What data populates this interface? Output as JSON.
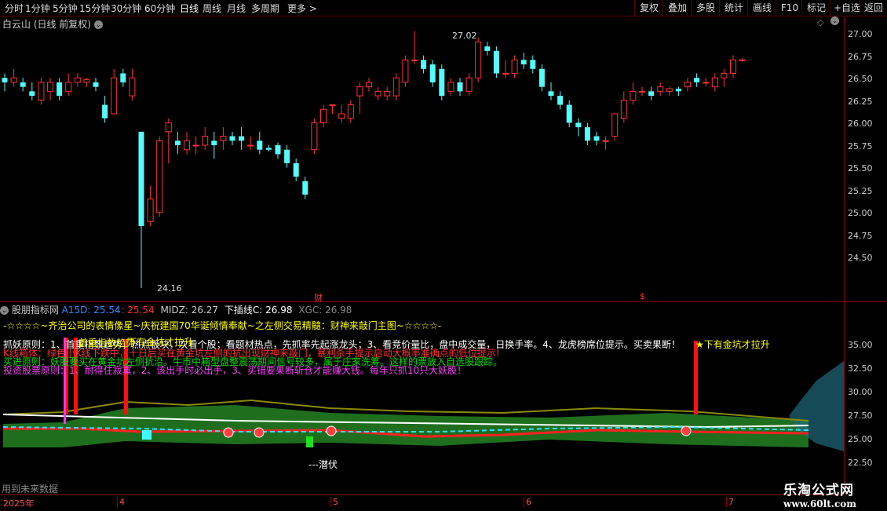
{
  "toolbar": {
    "periods": [
      "分时",
      "1分钟",
      "5分钟",
      "15分钟",
      "30分钟",
      "60分钟",
      "日线",
      "周线",
      "月线",
      "多周期",
      "更多 >"
    ],
    "active_period": "日线",
    "right_buttons": [
      "复权",
      "叠加",
      "多股",
      "统计",
      "画线",
      "F10",
      "标记",
      "+自选",
      "返回"
    ]
  },
  "stock": {
    "title": "白云山 (日线 前复权)"
  },
  "main_axis": {
    "labels": [
      "27.00",
      "26.75",
      "26.50",
      "26.25",
      "26.00",
      "25.75",
      "25.50",
      "25.25",
      "25.00",
      "24.75",
      "24.50"
    ],
    "high_label": "27.02",
    "low_label": "24.16",
    "markers": [
      "财",
      "$"
    ]
  },
  "indicator": {
    "name": "股朋指标网",
    "a15d_label": "A15D: 25.54",
    "a15d_value": ": 25.54",
    "midz": "MIDZ: 26.27",
    "xcz": "下插线C: 26.98",
    "xgc": "XGC: 26.98",
    "banner": "-☆☆☆☆~齐治公司的表情像星~庆祝建国70华诞倾情奉献~之左侧交易精髓：财神来敲门主图~☆☆☆☆-",
    "line1": "抓妖原则：1、首重指数趋势，热点板块，次看个股；看题材热点，先抓率先起涨龙头；3、看竞价量比，盘中成交量，日换手率。4、龙虎榜席位提示。买卖果断！",
    "line2": "K线箱体：绿色小K线下跌中，十日后买在黄金坑左侧的抗出现财神来敲门，暴利杀手提示启动大概率准确点的低位提示!",
    "line3": "买进原则：妖股要买在黄金坑左侧抗沿。牛市中箱型盘整震荡期间信号较多，属于庄家洗筹。这样的票放入自选股跟踪。",
    "line4": "投资股票原则：1、耐得住寂寞，2、该出手时必出手，3、买错要果断斩仓才能赚大钱。每年只抓10只大妖股！",
    "overlap_a": "首重指数趋势",
    "overlap_b": "下有金坑才拉升",
    "annot_right": "★下有金坑才拉升",
    "qianfu": "---潜伏",
    "axis_labels": [
      "35.00",
      "32.50",
      "30.00",
      "27.50",
      "25.00",
      "22.50"
    ]
  },
  "footer": {
    "future_data": "用到未来数据",
    "dates": [
      "2025年",
      "4",
      "5",
      "6",
      "7"
    ]
  },
  "watermark": {
    "name": "乐淘公式网",
    "url": "www.60lt.com"
  },
  "colors": {
    "up": "#ff3232",
    "down": "#54fcfc",
    "frame": "#8b0000",
    "yellow": "#ffff00",
    "green_band": "#1e6e1e"
  }
}
